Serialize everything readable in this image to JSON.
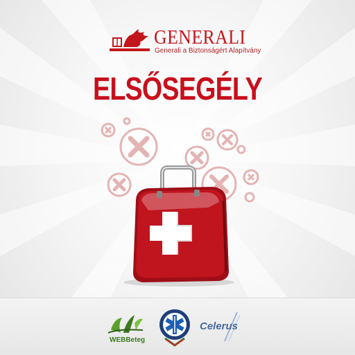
{
  "brand": {
    "name": "GENERALI",
    "subtitle": "Generali a Biztonságért Alapítvány",
    "color": "#c3161c"
  },
  "headline": "ELSŐSEGÉLY",
  "colors": {
    "headline": "#c8101c",
    "kit": "#b5121b",
    "cross": "#ffffff",
    "background_symbols": "#e5b5b5"
  },
  "illustration": {
    "subject": "first-aid-kit",
    "decoration": "plus-circle-icons"
  },
  "sponsors": [
    {
      "name": "WEBBeteg",
      "icon": "webbeteg-logo"
    },
    {
      "name": "",
      "icon": "ambulance-service-emblem"
    },
    {
      "name": "Celerus",
      "icon": "celerus-logo"
    }
  ]
}
